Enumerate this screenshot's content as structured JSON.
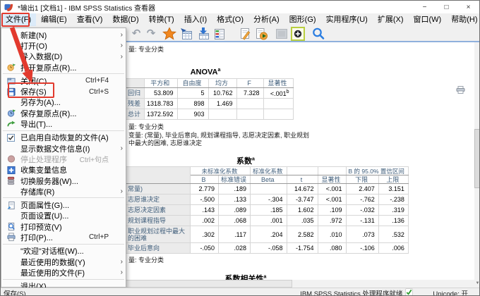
{
  "window": {
    "title": "*输出1 [文档1] - IBM SPSS Statistics 查看器",
    "controls": {
      "minimize": "−",
      "maximize": "□",
      "close": "×"
    }
  },
  "menu_bar": {
    "items": [
      {
        "label": "文件(F)",
        "active": true
      },
      {
        "label": "编辑(E)"
      },
      {
        "label": "查看(V)"
      },
      {
        "label": "数据(D)"
      },
      {
        "label": "转换(T)"
      },
      {
        "label": "插入(I)"
      },
      {
        "label": "格式(O)"
      },
      {
        "label": "分析(A)"
      },
      {
        "label": "图形(G)"
      },
      {
        "label": "实用程序(U)"
      },
      {
        "label": "扩展(X)"
      },
      {
        "label": "窗口(W)"
      },
      {
        "label": "帮助(H)"
      }
    ]
  },
  "toolbar": {
    "icons": [
      "undo-icon",
      "redo-icon",
      "designate-window-star-icon",
      "goto-data-icon",
      "export-output-icon",
      "variables-icon",
      "edit-output-icon",
      "run-script-icon",
      "inactive-box-icon",
      "select-tool-icon",
      "find-icon"
    ]
  },
  "file_menu": {
    "items": [
      {
        "label": "新建(N)",
        "submenu": true
      },
      {
        "label": "打开(O)",
        "submenu": true
      },
      {
        "label": "导入数据(D)",
        "submenu": true
      },
      {
        "label": "打开复原点(R)...",
        "icon": "restore-open-icon"
      },
      {
        "separator": true
      },
      {
        "label": "关闭(C)",
        "shortcut": "Ctrl+F4",
        "icon": "close-doc-icon"
      },
      {
        "label": "保存(S)",
        "shortcut": "Ctrl+S",
        "icon": "save-icon",
        "annotated": true
      },
      {
        "label": "另存为(A)..."
      },
      {
        "label": "保存复原点(R)...",
        "icon": "restore-save-icon"
      },
      {
        "label": "导出(T)...",
        "icon": "export-menu-icon"
      },
      {
        "separator": true
      },
      {
        "label": "已启用自动恢复的文件(A)",
        "checkbox": true,
        "checked": true
      },
      {
        "label": "显示数据文件信息(I)",
        "submenu": true
      },
      {
        "label": "停止处理程序",
        "shortcut": "Ctrl+句点",
        "icon": "stop-icon",
        "disabled": true
      },
      {
        "label": "收集变量信息",
        "icon": "collect-variable-icon"
      },
      {
        "label": "切换服务器(W)...",
        "icon": "server-icon"
      },
      {
        "label": "存储库(R)",
        "submenu": true
      },
      {
        "separator": true
      },
      {
        "label": "页面属性(G)...",
        "icon": "page-attr-icon"
      },
      {
        "label": "页面设置(U)..."
      },
      {
        "label": "打印预览(V)",
        "icon": "print-preview-icon"
      },
      {
        "label": "打印(P)...",
        "shortcut": "Ctrl+P",
        "icon": "print-icon"
      },
      {
        "separator": true
      },
      {
        "label": "\"欢迎\"对话框(W)..."
      },
      {
        "label": "最近使用的数据(Y)",
        "submenu": true
      },
      {
        "label": "最近使用的文件(F)",
        "submenu": true
      },
      {
        "separator": true
      },
      {
        "label": "退出(X)"
      }
    ]
  },
  "annotation": {
    "color": "#e23a2e"
  },
  "output": {
    "top_note": "量: 专业分类",
    "anova": {
      "title": "ANOVA",
      "title_sup": "a",
      "columns": [
        "平方和",
        "自由度",
        "均方",
        "F",
        "显著性"
      ],
      "rows": [
        {
          "label": "回归",
          "cells": [
            "53.809",
            "5",
            "10.762",
            "7.328",
            "<.001"
          ],
          "sig_sup": "b"
        },
        {
          "label": "残差",
          "cells": [
            "1318.783",
            "898",
            "1.469",
            "",
            ""
          ]
        },
        {
          "label": "总计",
          "cells": [
            "1372.592",
            "903",
            "",
            "",
            ""
          ]
        }
      ],
      "footnote": "量: 专业分类"
    },
    "predictors_note_line1": "变量: (常量), 毕业后意向, 规划课程指导, 志愿决定因素, 职业规划",
    "predictors_note_line2": "中最大的困难, 志愿谁决定",
    "coefficients": {
      "title": "系数",
      "title_sup": "a",
      "group_headers": {
        "unstd": "未标准化系数",
        "std": "标准化系数",
        "ci": "B 的 95.0% 置信区间"
      },
      "columns": [
        "B",
        "标准错误",
        "Beta",
        "t",
        "显著性",
        "下限",
        "上限"
      ],
      "rows": [
        {
          "label": "常量)",
          "cells": [
            "2.779",
            ".189",
            "",
            "14.672",
            "<.001",
            "2.407",
            "3.151"
          ]
        },
        {
          "label": "志愿谁决定",
          "cells": [
            "-.500",
            ".133",
            "-.304",
            "-3.747",
            "<.001",
            "-.762",
            "-.238"
          ]
        },
        {
          "label": "志愿决定因素",
          "cells": [
            ".143",
            ".089",
            ".185",
            "1.602",
            ".109",
            "-.032",
            ".319"
          ]
        },
        {
          "label": "规划课程指导",
          "cells": [
            ".002",
            ".068",
            ".001",
            ".035",
            ".972",
            "-.131",
            ".136"
          ]
        },
        {
          "label": "职业规划过程中最大的困难",
          "cells": [
            ".302",
            ".117",
            ".204",
            "2.582",
            ".010",
            ".073",
            ".532"
          ],
          "wrap": true
        },
        {
          "label": "毕业后意向",
          "cells": [
            "-.050",
            ".028",
            "-.058",
            "-1.754",
            ".080",
            "-.106",
            ".006"
          ]
        }
      ],
      "footnote": "量: 专业分类"
    },
    "next_table_title": "系数相关性",
    "next_table_title_sup": "a"
  },
  "status_bar": {
    "left": "保存(S)",
    "processor": "IBM SPSS Statistics 处理程序就绪",
    "unicode": "Unicode: 开"
  }
}
